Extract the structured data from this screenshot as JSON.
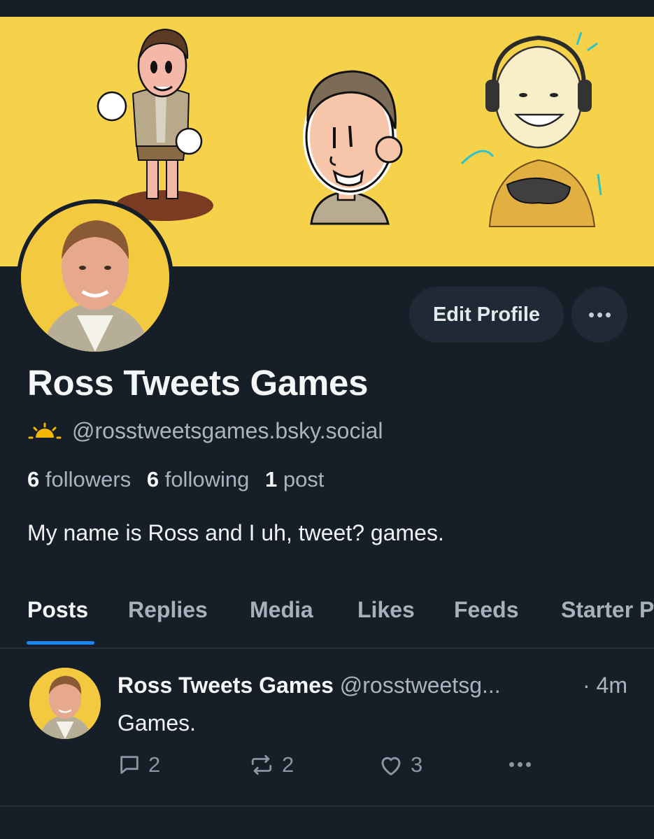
{
  "profile": {
    "display_name": "Ross Tweets Games",
    "handle": "@rosstweetsgames.bsky.social",
    "bio": "My name is Ross and I uh, tweet? games.",
    "stats": {
      "followers_count": "6",
      "followers_label": "followers",
      "following_count": "6",
      "following_label": "following",
      "posts_count": "1",
      "posts_label": "post"
    },
    "edit_profile_label": "Edit Profile"
  },
  "tabs": [
    {
      "label": "Posts",
      "active": true
    },
    {
      "label": "Replies",
      "active": false
    },
    {
      "label": "Media",
      "active": false
    },
    {
      "label": "Likes",
      "active": false
    },
    {
      "label": "Feeds",
      "active": false
    },
    {
      "label": "Starter Packs",
      "active": false
    }
  ],
  "post": {
    "author": "Ross Tweets Games",
    "handle": "@rosstweetsg...",
    "time": "· 4m",
    "text": "Games.",
    "reply_count": "2",
    "repost_count": "2",
    "like_count": "3"
  },
  "colors": {
    "background": "#161e27",
    "banner": "#f6d24a",
    "accent": "#1b85f2",
    "muted_text": "#aab4bf"
  },
  "icons": [
    "sun-badge-icon",
    "more-icon",
    "reply-icon",
    "repost-icon",
    "like-icon"
  ]
}
